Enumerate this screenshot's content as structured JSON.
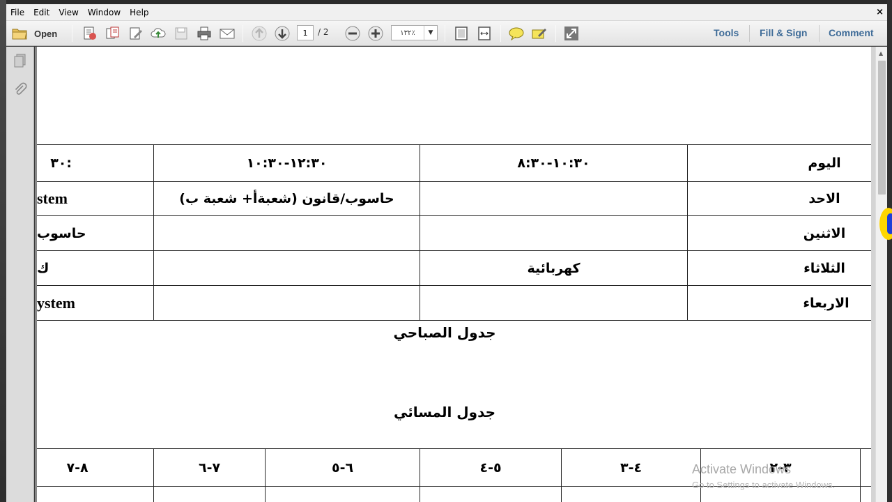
{
  "menu": [
    "File",
    "Edit",
    "View",
    "Window",
    "Help"
  ],
  "close_glyph": "×",
  "toolbar": {
    "open_label": "Open",
    "page_current": "1",
    "page_total": "/ 2",
    "zoom_value": "١٣٢٪",
    "zoom_arrow": "▼"
  },
  "right_links": [
    "Tools",
    "Fill & Sign",
    "Comment"
  ],
  "morning_table": {
    "header": [
      ":٣٠",
      "١٢:٣٠-١٠:٣٠",
      "١٠:٣٠-٨:٣٠",
      "اليوم"
    ],
    "rows": [
      [
        "stem",
        "حاسوب/قانون (شعبةأ+ شعبة ب)",
        "",
        "الاحد"
      ],
      [
        "حاسوب",
        "",
        "",
        "الاثنين"
      ],
      [
        "ك",
        "",
        "كهربائية",
        "الثلاثاء"
      ],
      [
        "ystem",
        "",
        "",
        "الاربعاء"
      ]
    ]
  },
  "title_morning": "جدول الصباحي",
  "title_evening": "جدول المسائي",
  "evening_table": {
    "header": [
      "٨-٧",
      "٧-٦",
      "٦-٥",
      "٥-٤",
      "٤-٣",
      "٣-٢"
    ]
  },
  "watermark": {
    "line1": "Activate Windows",
    "line2": "Go to Settings to activate Windows."
  },
  "icons": [
    "folder-icon",
    "create-pdf-icon",
    "combine-icon",
    "edit-icon",
    "upload-cloud-icon",
    "save-icon",
    "print-icon",
    "email-icon",
    "prev-page-icon",
    "next-page-icon",
    "zoom-out-icon",
    "zoom-in-icon",
    "fit-page-icon",
    "fit-width-icon",
    "comment-bubble-icon",
    "highlight-icon",
    "fullscreen-icon",
    "pages-panel-icon",
    "attachment-icon"
  ]
}
